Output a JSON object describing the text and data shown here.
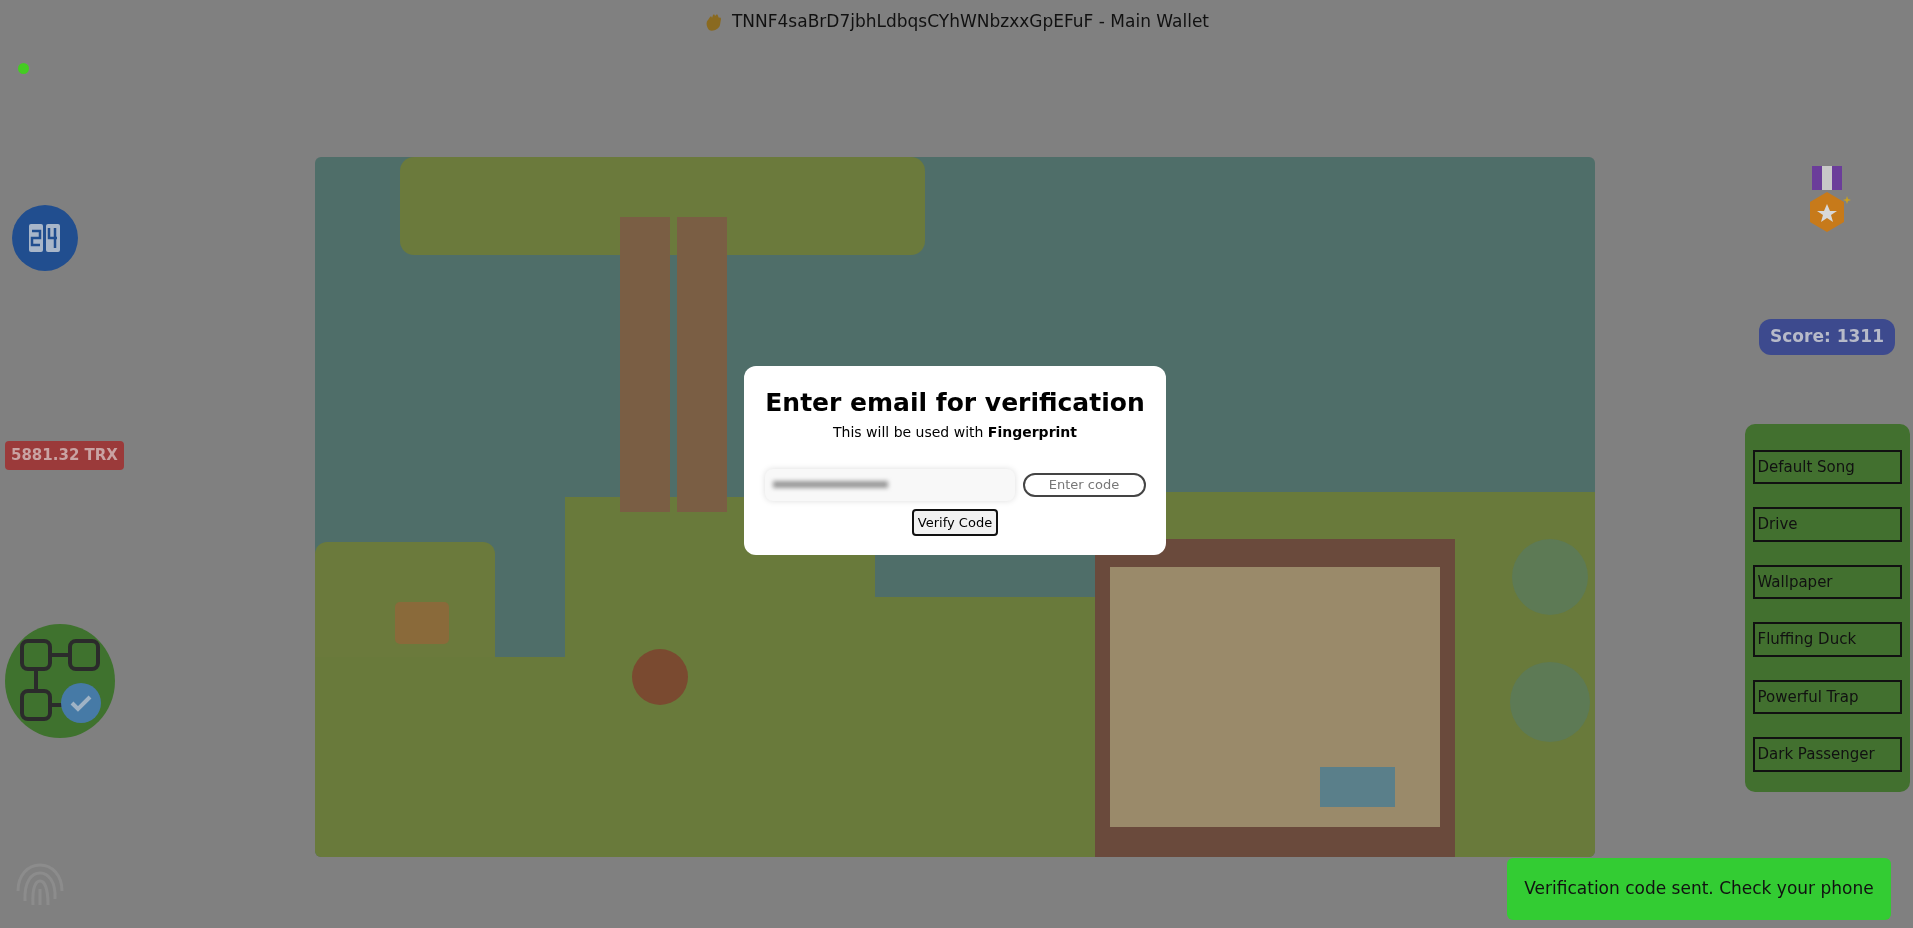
{
  "header": {
    "title": "TNNF4saBrD7jbhLdbqsCYhWNbzxxGpEFuF - Main Wallet"
  },
  "balance": "5881.32 TRX",
  "score": "Score: 1311",
  "modal": {
    "title": "Enter email for verification",
    "subtitle": "This will be used with **Fingerprint**",
    "email_field": {
      "blurred": true
    },
    "code_field": {
      "placeholder": "Enter code"
    },
    "verify_button": "Verify Code"
  },
  "songs": [
    "Default Song",
    "Drive",
    "Wallpaper",
    "Fluffing Duck",
    "Powerful Trap",
    "Dark Passenger"
  ],
  "toast": "Verification code sent. Check your phone"
}
